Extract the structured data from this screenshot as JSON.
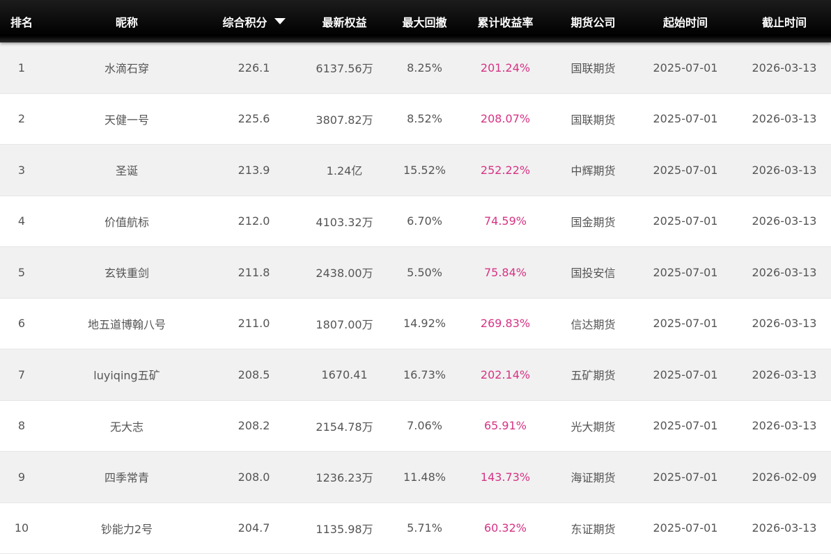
{
  "table": {
    "headers": {
      "rank": "排名",
      "nickname": "昵称",
      "score": "综合积分",
      "equity": "最新权益",
      "max_drawdown": "最大回撤",
      "cum_return": "累计收益率",
      "company": "期货公司",
      "start": "起始时间",
      "end": "截止时间"
    },
    "sort": {
      "column": "score",
      "direction": "desc"
    },
    "colors": {
      "header_bg": "#000000",
      "header_text": "#ffffff",
      "row_alt_bg": "#f1f1f1",
      "text": "#555555",
      "return_text": "#d63384"
    },
    "rows": [
      {
        "rank": "1",
        "nickname": "水滴石穿",
        "score": "226.1",
        "equity": "6137.56万",
        "max_drawdown": "8.25%",
        "cum_return": "201.24%",
        "company": "国联期货",
        "start": "2025-07-01",
        "end": "2026-03-13"
      },
      {
        "rank": "2",
        "nickname": "天健一号",
        "score": "225.6",
        "equity": "3807.82万",
        "max_drawdown": "8.52%",
        "cum_return": "208.07%",
        "company": "国联期货",
        "start": "2025-07-01",
        "end": "2026-03-13"
      },
      {
        "rank": "3",
        "nickname": "圣诞",
        "score": "213.9",
        "equity": "1.24亿",
        "max_drawdown": "15.52%",
        "cum_return": "252.22%",
        "company": "中辉期货",
        "start": "2025-07-01",
        "end": "2026-03-13"
      },
      {
        "rank": "4",
        "nickname": "价值航标",
        "score": "212.0",
        "equity": "4103.32万",
        "max_drawdown": "6.70%",
        "cum_return": "74.59%",
        "company": "国金期货",
        "start": "2025-07-01",
        "end": "2026-03-13"
      },
      {
        "rank": "5",
        "nickname": "玄铁重剑",
        "score": "211.8",
        "equity": "2438.00万",
        "max_drawdown": "5.50%",
        "cum_return": "75.84%",
        "company": "国投安信",
        "start": "2025-07-01",
        "end": "2026-03-13"
      },
      {
        "rank": "6",
        "nickname": "地五道博翰八号",
        "score": "211.0",
        "equity": "1807.00万",
        "max_drawdown": "14.92%",
        "cum_return": "269.83%",
        "company": "信达期货",
        "start": "2025-07-01",
        "end": "2026-03-13"
      },
      {
        "rank": "7",
        "nickname": "luyiqing五矿",
        "score": "208.5",
        "equity": "1670.41",
        "max_drawdown": "16.73%",
        "cum_return": "202.14%",
        "company": "五矿期货",
        "start": "2025-07-01",
        "end": "2026-03-13"
      },
      {
        "rank": "8",
        "nickname": "无大志",
        "score": "208.2",
        "equity": "2154.78万",
        "max_drawdown": "7.06%",
        "cum_return": "65.91%",
        "company": "光大期货",
        "start": "2025-07-01",
        "end": "2026-03-13"
      },
      {
        "rank": "9",
        "nickname": "四季常青",
        "score": "208.0",
        "equity": "1236.23万",
        "max_drawdown": "11.48%",
        "cum_return": "143.73%",
        "company": "海证期货",
        "start": "2025-07-01",
        "end": "2026-02-09"
      },
      {
        "rank": "10",
        "nickname": "钞能力2号",
        "score": "204.7",
        "equity": "1135.98万",
        "max_drawdown": "5.71%",
        "cum_return": "60.32%",
        "company": "东证期货",
        "start": "2025-07-01",
        "end": "2026-03-13"
      }
    ]
  }
}
